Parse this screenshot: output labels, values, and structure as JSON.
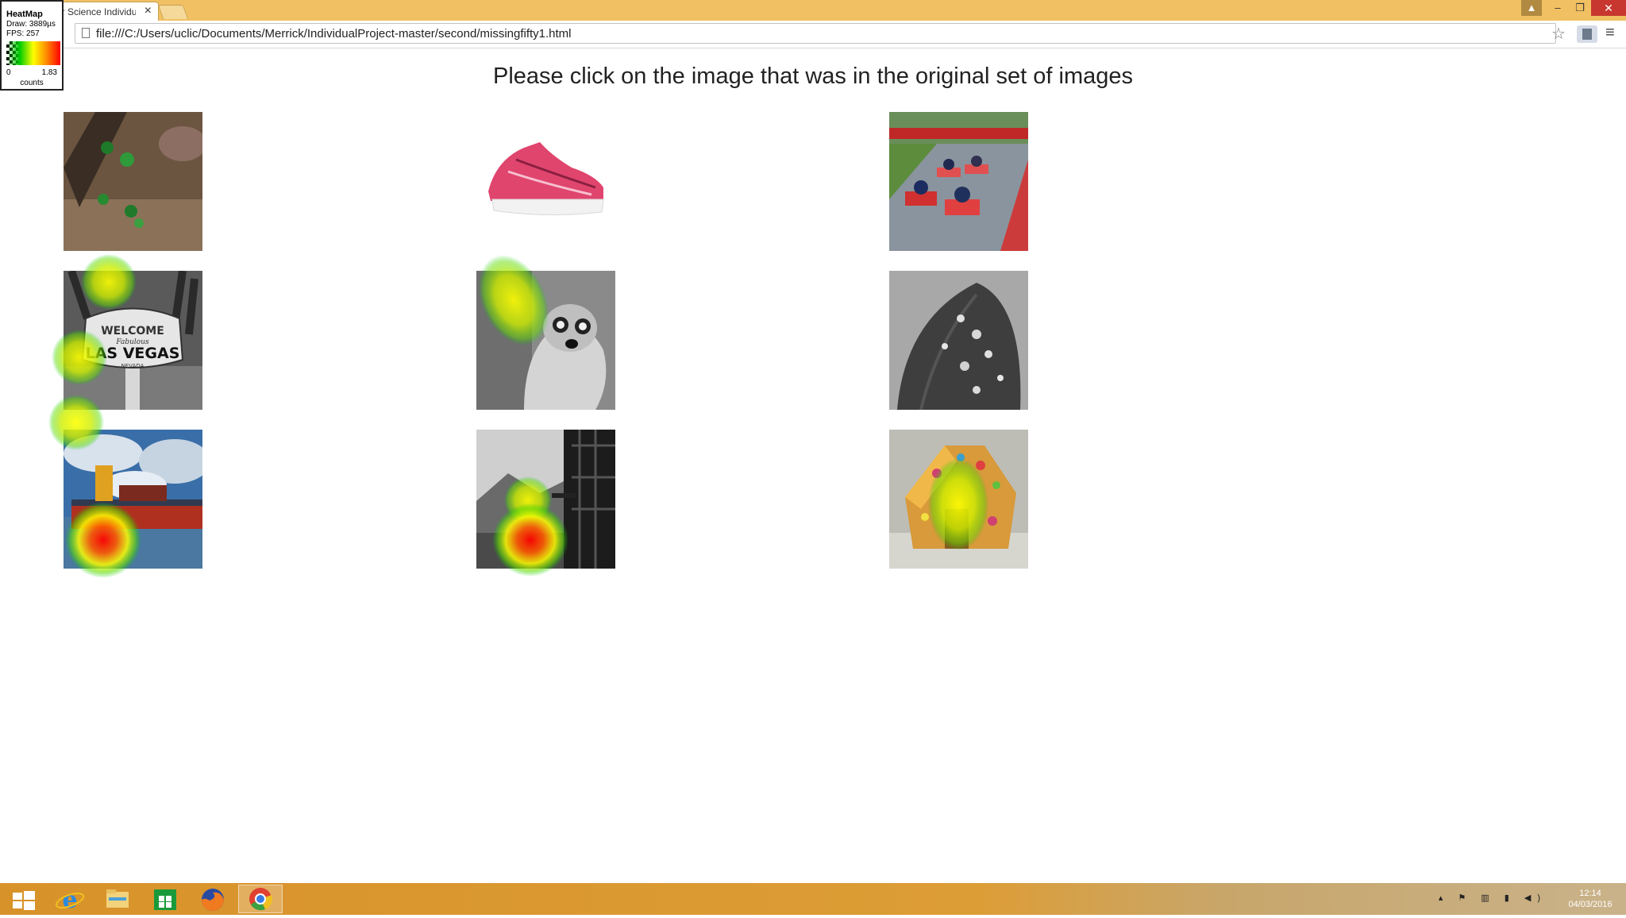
{
  "browser": {
    "tab_title": "er Science Individu",
    "tab_close": "×",
    "url": "file:///C:/Users/uclic/Documents/Merrick/IndividualProject-master/second/missingfifty1.html",
    "window_controls": {
      "minimize": "–",
      "maximize": "❐",
      "close": "✕"
    },
    "icons": {
      "star": "☆",
      "menu": "≡"
    }
  },
  "heatmap_widget": {
    "title": "HeatMap",
    "draw": "Draw: 3889µs",
    "fps": "FPS: 257",
    "scale_min": "0",
    "scale_max": "1.83",
    "unit": "counts"
  },
  "page": {
    "instruction": "Please click on the image that was in the original set of images",
    "images": [
      {
        "name": "beetles-on-wood",
        "subject": "green beetles on bark",
        "palette": [
          "#5a4636",
          "#7d6a55",
          "#2e8a2e"
        ]
      },
      {
        "name": "pink-sneaker",
        "subject": "pink running shoe",
        "palette": [
          "#ffffff",
          "#e0456e",
          "#f6f6f6"
        ]
      },
      {
        "name": "go-karts",
        "subject": "go-kart racing",
        "palette": [
          "#8a9aa8",
          "#5c8c3c",
          "#d03030"
        ]
      },
      {
        "name": "las-vegas-sign",
        "subject": "Welcome to Fabulous Las Vegas Nevada sign",
        "palette": [
          "#555555",
          "#dddddd",
          "#222222"
        ],
        "sign_lines": [
          "WELCOME",
          "Fabulous",
          "LAS VEGAS",
          "NEVADA"
        ]
      },
      {
        "name": "lemur",
        "subject": "ring-tailed lemur",
        "palette": [
          "#777777",
          "#cccccc",
          "#222222"
        ]
      },
      {
        "name": "leaf-droplets",
        "subject": "water droplets on leaf",
        "palette": [
          "#888888",
          "#333333",
          "#dddddd"
        ]
      },
      {
        "name": "cargo-ship",
        "subject": "cargo ship under stormy sky",
        "palette": [
          "#3a6ea8",
          "#cfdbe8",
          "#b03020"
        ]
      },
      {
        "name": "balcony-view",
        "subject": "mountain view from balcony",
        "palette": [
          "#999999",
          "#eeeeee",
          "#222222"
        ]
      },
      {
        "name": "gingerbread-house",
        "subject": "candy gingerbread house",
        "palette": [
          "#c8c8c0",
          "#e0a040",
          "#d04070"
        ]
      }
    ]
  },
  "heat_blobs": [
    {
      "image": "las-vegas-sign",
      "intensity": 0.45
    },
    {
      "image": "las-vegas-sign",
      "intensity": 0.45
    },
    {
      "image": "las-vegas-sign",
      "intensity": 0.45
    },
    {
      "image": "lemur",
      "intensity": 0.55
    },
    {
      "image": "cargo-ship",
      "intensity": 1.0
    },
    {
      "image": "balcony-view",
      "intensity": 0.5
    },
    {
      "image": "balcony-view",
      "intensity": 1.0
    },
    {
      "image": "gingerbread-house",
      "intensity": 0.6
    }
  ],
  "taskbar": {
    "apps": [
      "start",
      "internet-explorer",
      "file-explorer",
      "store",
      "firefox",
      "chrome"
    ],
    "tray": "▴ ⚑ ▥ ▮ ◀)",
    "time": "12:14",
    "date": "04/03/2016"
  }
}
